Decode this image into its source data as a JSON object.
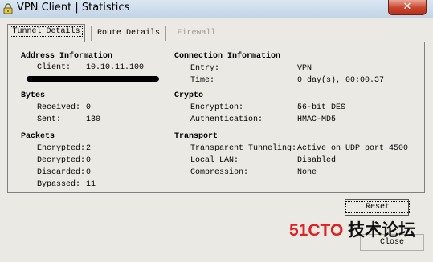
{
  "window": {
    "title": "VPN Client | Statistics",
    "close_glyph": "✕"
  },
  "tabs": [
    {
      "label": "Tunnel Details",
      "active": true,
      "enabled": true
    },
    {
      "label": "Route Details",
      "active": false,
      "enabled": true
    },
    {
      "label": "Firewall",
      "active": false,
      "enabled": false
    }
  ],
  "address_information": {
    "heading": "Address Information",
    "client_label": "Client:",
    "client_value": "10.10.11.100"
  },
  "bytes": {
    "heading": "Bytes",
    "received_label": "Received:",
    "received_value": "0",
    "sent_label": "Sent:",
    "sent_value": "130"
  },
  "packets": {
    "heading": "Packets",
    "encrypted_label": "Encrypted:",
    "encrypted_value": "2",
    "decrypted_label": "Decrypted:",
    "decrypted_value": "0",
    "discarded_label": "Discarded:",
    "discarded_value": "0",
    "bypassed_label": "Bypassed:",
    "bypassed_value": "11"
  },
  "connection_information": {
    "heading": "Connection Information",
    "entry_label": "Entry:",
    "entry_value": "VPN",
    "time_label": "Time:",
    "time_value": "0 day(s), 00:00.37"
  },
  "crypto": {
    "heading": "Crypto",
    "encryption_label": "Encryption:",
    "encryption_value": "56-bit DES",
    "authentication_label": "Authentication:",
    "authentication_value": "HMAC-MD5"
  },
  "transport": {
    "heading": "Transport",
    "transparent_tunneling_label": "Transparent Tunneling:",
    "transparent_tunneling_value": "Active on UDP port 4500",
    "local_lan_label": "Local LAN:",
    "local_lan_value": "Disabled",
    "compression_label": "Compression:",
    "compression_value": "None"
  },
  "buttons": {
    "reset_label": "Reset",
    "close_label": "Close"
  },
  "watermark": {
    "part1": "51CTO",
    "part2": " 技术论坛"
  },
  "colors": {
    "title_bar": "#c3d4e6",
    "dialog_bg": "#ebe9e3",
    "close_button": "#c8432b",
    "watermark_red": "#e02020"
  }
}
